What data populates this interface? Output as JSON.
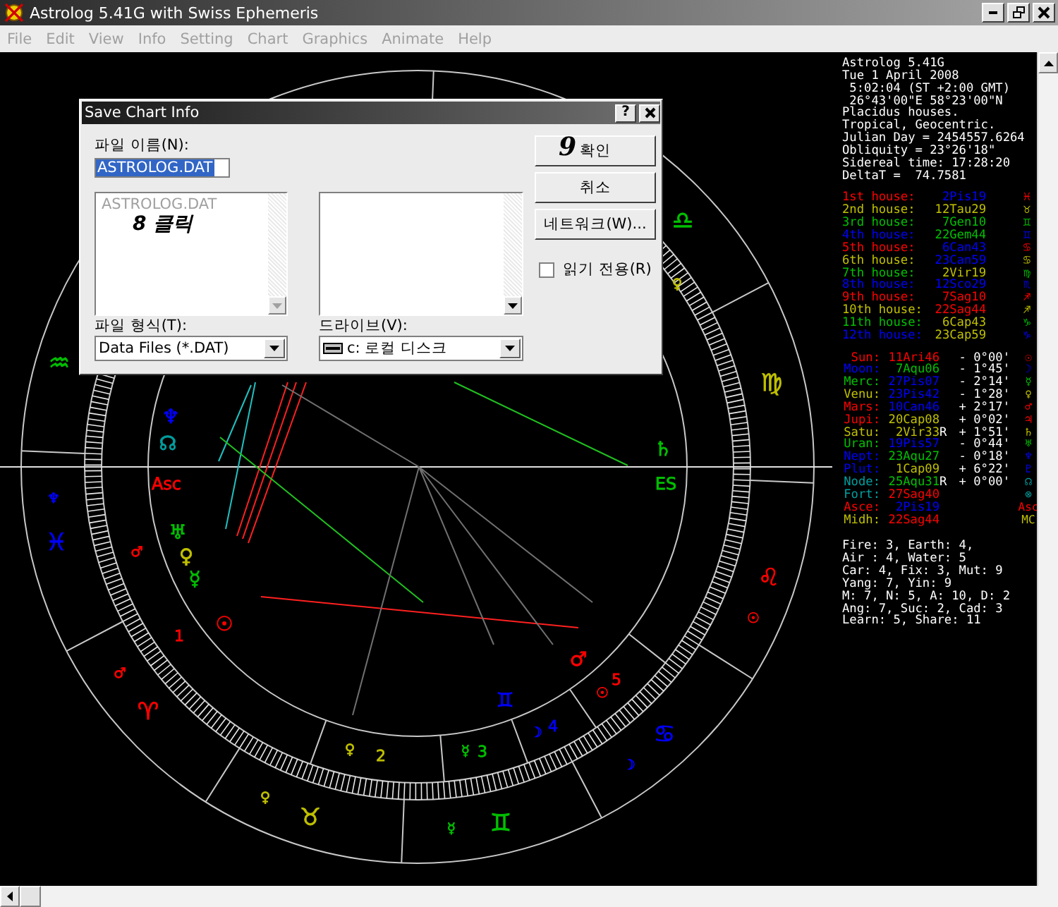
{
  "window": {
    "title": "Astrolog 5.41G with Swiss Ephemeris",
    "menu": [
      "File",
      "Edit",
      "View",
      "Info",
      "Setting",
      "Chart",
      "Graphics",
      "Animate",
      "Help"
    ]
  },
  "chart": {
    "labels": [
      {
        "text": "♒",
        "color": "#00c000",
        "kind": "sign"
      },
      {
        "text": "♆",
        "color": "#0000ff",
        "kind": "small"
      },
      {
        "text": "♓",
        "color": "#0000ff",
        "kind": "sign"
      },
      {
        "text": "♂",
        "color": "#ff0000",
        "kind": "small"
      },
      {
        "text": "♂",
        "color": "#ff0000",
        "kind": "small"
      },
      {
        "text": "♈",
        "color": "#ff0000",
        "kind": "sign"
      },
      {
        "text": "1",
        "color": "#ff0000",
        "kind": "number"
      },
      {
        "text": "♆",
        "color": "#0000ff",
        "kind": "planet"
      },
      {
        "text": "☊",
        "color": "#00a0a0",
        "kind": "planet"
      },
      {
        "text": "Asc",
        "color": "#ff0000",
        "kind": "axis"
      },
      {
        "text": "♅",
        "color": "#00c000",
        "kind": "planet"
      },
      {
        "text": "♀",
        "color": "#c0c000",
        "kind": "planet"
      },
      {
        "text": "☿",
        "color": "#00c000",
        "kind": "planet"
      },
      {
        "text": "☉",
        "color": "#ff0000",
        "kind": "planet"
      },
      {
        "text": "♀",
        "color": "#c0c000",
        "kind": "small"
      },
      {
        "text": "2",
        "color": "#c0c000",
        "kind": "number"
      },
      {
        "text": "☿",
        "color": "#00c000",
        "kind": "small"
      },
      {
        "text": "3",
        "color": "#00c000",
        "kind": "number"
      },
      {
        "text": "♊",
        "color": "#0000ff",
        "kind": "planet"
      },
      {
        "text": "☽",
        "color": "#0000ff",
        "kind": "small"
      },
      {
        "text": "4",
        "color": "#0000ff",
        "kind": "number"
      },
      {
        "text": "♂",
        "color": "#ff0000",
        "kind": "planet"
      },
      {
        "text": "☉",
        "color": "#ff0000",
        "kind": "small"
      },
      {
        "text": "5",
        "color": "#ff0000",
        "kind": "number"
      },
      {
        "text": "♋",
        "color": "#0000ff",
        "kind": "sign"
      },
      {
        "text": "☽",
        "color": "#0000ff",
        "kind": "small"
      },
      {
        "text": "☉",
        "color": "#ff0000",
        "kind": "small"
      },
      {
        "text": "♉",
        "color": "#c0c000",
        "kind": "sign"
      },
      {
        "text": "♀",
        "color": "#c0c000",
        "kind": "small"
      },
      {
        "text": "☿",
        "color": "#00c000",
        "kind": "small"
      },
      {
        "text": "♊",
        "color": "#00c000",
        "kind": "sign"
      },
      {
        "text": "♌",
        "color": "#ff0000",
        "kind": "sign"
      },
      {
        "text": "♍",
        "color": "#c0c000",
        "kind": "sign"
      },
      {
        "text": "♎",
        "color": "#00c000",
        "kind": "sign"
      },
      {
        "text": "♀",
        "color": "#c0c000",
        "kind": "small"
      },
      {
        "text": "♄",
        "color": "#00c000",
        "kind": "planet"
      },
      {
        "text": "ES",
        "color": "#00c000",
        "kind": "axis"
      }
    ]
  },
  "info_panel": {
    "header": [
      "Astrolog 5.41G",
      "Tue 1 April 2008",
      " 5:02:04 (ST +2:00 GMT)",
      " 26°43'00\"E 58°23'00\"N",
      "Placidus houses.",
      "Tropical, Geocentric.",
      "Julian Day = 2454557.6264",
      "Obliquity = 23°26'18\"",
      "Sidereal time: 17:28:20",
      "DeltaT =  74.7581"
    ],
    "houses": [
      {
        "label": "1st house:",
        "position": {
          "text": "2Pis19",
          "color": "#0000ff"
        },
        "glyph": "♓",
        "color": "#ff0000"
      },
      {
        "label": "2nd house:",
        "position": {
          "text": "12Tau29",
          "color": "#c0c000"
        },
        "glyph": "♉",
        "color": "#c0c000"
      },
      {
        "label": "3rd house:",
        "position": {
          "text": "7Gen10",
          "color": "#00c000"
        },
        "glyph": "♊",
        "color": "#00c000"
      },
      {
        "label": "4th house:",
        "position": {
          "text": "22Gem44",
          "color": "#00c000"
        },
        "glyph": "♊",
        "color": "#0000ff"
      },
      {
        "label": "5th house:",
        "position": {
          "text": "6Can43",
          "color": "#0000ff"
        },
        "glyph": "♋",
        "color": "#ff0000"
      },
      {
        "label": "6th house:",
        "position": {
          "text": "23Can59",
          "color": "#0000ff"
        },
        "glyph": "♋",
        "color": "#c0c000"
      },
      {
        "label": "7th house:",
        "position": {
          "text": "2Vir19",
          "color": "#c0c000"
        },
        "glyph": "♍",
        "color": "#00c000"
      },
      {
        "label": "8th house:",
        "position": {
          "text": "12Sco29",
          "color": "#0000ff"
        },
        "glyph": "♏",
        "color": "#0000ff"
      },
      {
        "label": "9th house:",
        "position": {
          "text": "7Sag10",
          "color": "#ff0000"
        },
        "glyph": "♐",
        "color": "#ff0000"
      },
      {
        "label": "10th house:",
        "position": {
          "text": "22Sag44",
          "color": "#ff0000"
        },
        "glyph": "♐",
        "color": "#c0c000"
      },
      {
        "label": "11th house:",
        "position": {
          "text": "6Cap43",
          "color": "#c0c000"
        },
        "glyph": "♑",
        "color": "#00c000"
      },
      {
        "label": "12th house:",
        "position": {
          "text": "23Cap59",
          "color": "#c0c000"
        },
        "glyph": "♑",
        "color": "#0000ff"
      }
    ],
    "planets": [
      {
        "name": "Sun:",
        "position": {
          "text": "11Ari46",
          "color": "#ff0000"
        },
        "motion": "- 0°00'",
        "glyph": "☉",
        "color": "#ff0000"
      },
      {
        "name": "Moon:",
        "position": {
          "text": "7Aqu06",
          "color": "#00c000"
        },
        "motion": "- 1°45'",
        "glyph": "☽",
        "color": "#0000ff"
      },
      {
        "name": "Merc:",
        "position": {
          "text": "27Pis07",
          "color": "#0000ff"
        },
        "motion": "- 2°14'",
        "glyph": "☿",
        "color": "#00c000"
      },
      {
        "name": "Venu:",
        "position": {
          "text": "23Pis42",
          "color": "#0000ff"
        },
        "motion": "- 1°28'",
        "glyph": "♀",
        "color": "#c0c000"
      },
      {
        "name": "Mars:",
        "position": {
          "text": "10Can46",
          "color": "#0000ff"
        },
        "motion": "+ 2°17'",
        "glyph": "♂",
        "color": "#ff0000"
      },
      {
        "name": "Jupi:",
        "position": {
          "text": "20Cap08",
          "color": "#c0c000"
        },
        "motion": "+ 0°02'",
        "glyph": "♃",
        "color": "#ff0000"
      },
      {
        "name": "Satu:",
        "position": {
          "text": "2Vir33",
          "color": "#c0c000"
        },
        "flag": "R",
        "motion": "+ 1°51'",
        "glyph": "♄",
        "color": "#c0c000"
      },
      {
        "name": "Uran:",
        "position": {
          "text": "19Pis57",
          "color": "#0000ff"
        },
        "motion": "- 0°44'",
        "glyph": "♅",
        "color": "#00c000"
      },
      {
        "name": "Nept:",
        "position": {
          "text": "23Aqu27",
          "color": "#00c000"
        },
        "motion": "- 0°18'",
        "glyph": "♆",
        "color": "#0000ff"
      },
      {
        "name": "Plut:",
        "position": {
          "text": "1Cap09",
          "color": "#c0c000"
        },
        "motion": "+ 6°22'",
        "glyph": "♇",
        "color": "#0000ff"
      },
      {
        "name": "Node:",
        "position": {
          "text": "25Aqu31",
          "color": "#00c000"
        },
        "flag": "R",
        "motion": "+ 0°00'",
        "glyph": "☊",
        "color": "#00a0a0"
      },
      {
        "name": "Fort:",
        "position": {
          "text": "27Sag40",
          "color": "#ff0000"
        },
        "glyph": "⊗",
        "color": "#00a0a0"
      },
      {
        "name": "Asce:",
        "position": {
          "text": "2Pis19",
          "color": "#0000ff"
        },
        "glyph": "Asc",
        "color": "#ff0000"
      },
      {
        "name": "Midh:",
        "position": {
          "text": "22Sag44",
          "color": "#ff0000"
        },
        "glyph": "MC",
        "color": "#c0c000"
      }
    ],
    "summary": [
      "Fire: 3, Earth: 4,",
      "Air : 4, Water: 5",
      "Car: 4, Fix: 3, Mut: 9",
      "Yang: 7, Yin: 9",
      "M: 7, N: 5, A: 10, D: 2",
      "Ang: 7, Suc: 2, Cad: 3",
      "Learn: 5, Share: 11"
    ]
  },
  "dialog": {
    "title": "Save Chart Info",
    "help_button": "?",
    "file_name_label": "파일 이름(N):",
    "file_name": {
      "value": "ASTROLOG.DAT",
      "selected": true
    },
    "file_list": [
      "ASTROLOG.DAT"
    ],
    "file_type_label": "파일 형식(T):",
    "file_type_value": "Data Files (*.DAT)",
    "drive_label": "드라이브(V):",
    "drive_value": "c: 로컬 디스크",
    "buttons": [
      "확인",
      "취소",
      "네트워크(W)..."
    ],
    "read_only": {
      "label": "읽기 전용(R)",
      "checked": false
    }
  },
  "annotations": [
    {
      "text": "8 클릭"
    },
    {
      "text": "9"
    }
  ]
}
